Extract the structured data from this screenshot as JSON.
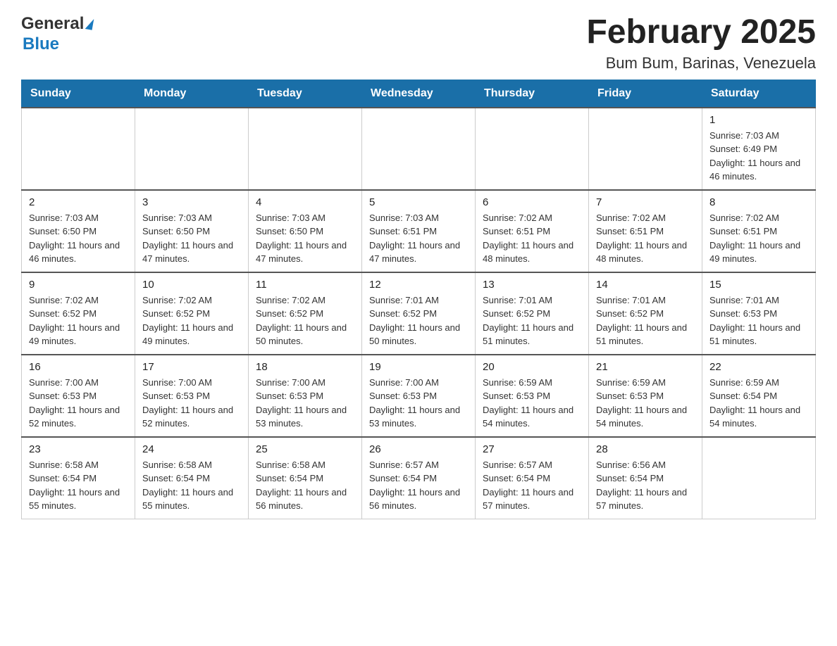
{
  "header": {
    "title": "February 2025",
    "location": "Bum Bum, Barinas, Venezuela",
    "logo_general": "General",
    "logo_blue": "Blue"
  },
  "weekdays": [
    "Sunday",
    "Monday",
    "Tuesday",
    "Wednesday",
    "Thursday",
    "Friday",
    "Saturday"
  ],
  "weeks": [
    [
      {
        "day": "",
        "info": ""
      },
      {
        "day": "",
        "info": ""
      },
      {
        "day": "",
        "info": ""
      },
      {
        "day": "",
        "info": ""
      },
      {
        "day": "",
        "info": ""
      },
      {
        "day": "",
        "info": ""
      },
      {
        "day": "1",
        "info": "Sunrise: 7:03 AM\nSunset: 6:49 PM\nDaylight: 11 hours and 46 minutes."
      }
    ],
    [
      {
        "day": "2",
        "info": "Sunrise: 7:03 AM\nSunset: 6:50 PM\nDaylight: 11 hours and 46 minutes."
      },
      {
        "day": "3",
        "info": "Sunrise: 7:03 AM\nSunset: 6:50 PM\nDaylight: 11 hours and 47 minutes."
      },
      {
        "day": "4",
        "info": "Sunrise: 7:03 AM\nSunset: 6:50 PM\nDaylight: 11 hours and 47 minutes."
      },
      {
        "day": "5",
        "info": "Sunrise: 7:03 AM\nSunset: 6:51 PM\nDaylight: 11 hours and 47 minutes."
      },
      {
        "day": "6",
        "info": "Sunrise: 7:02 AM\nSunset: 6:51 PM\nDaylight: 11 hours and 48 minutes."
      },
      {
        "day": "7",
        "info": "Sunrise: 7:02 AM\nSunset: 6:51 PM\nDaylight: 11 hours and 48 minutes."
      },
      {
        "day": "8",
        "info": "Sunrise: 7:02 AM\nSunset: 6:51 PM\nDaylight: 11 hours and 49 minutes."
      }
    ],
    [
      {
        "day": "9",
        "info": "Sunrise: 7:02 AM\nSunset: 6:52 PM\nDaylight: 11 hours and 49 minutes."
      },
      {
        "day": "10",
        "info": "Sunrise: 7:02 AM\nSunset: 6:52 PM\nDaylight: 11 hours and 49 minutes."
      },
      {
        "day": "11",
        "info": "Sunrise: 7:02 AM\nSunset: 6:52 PM\nDaylight: 11 hours and 50 minutes."
      },
      {
        "day": "12",
        "info": "Sunrise: 7:01 AM\nSunset: 6:52 PM\nDaylight: 11 hours and 50 minutes."
      },
      {
        "day": "13",
        "info": "Sunrise: 7:01 AM\nSunset: 6:52 PM\nDaylight: 11 hours and 51 minutes."
      },
      {
        "day": "14",
        "info": "Sunrise: 7:01 AM\nSunset: 6:52 PM\nDaylight: 11 hours and 51 minutes."
      },
      {
        "day": "15",
        "info": "Sunrise: 7:01 AM\nSunset: 6:53 PM\nDaylight: 11 hours and 51 minutes."
      }
    ],
    [
      {
        "day": "16",
        "info": "Sunrise: 7:00 AM\nSunset: 6:53 PM\nDaylight: 11 hours and 52 minutes."
      },
      {
        "day": "17",
        "info": "Sunrise: 7:00 AM\nSunset: 6:53 PM\nDaylight: 11 hours and 52 minutes."
      },
      {
        "day": "18",
        "info": "Sunrise: 7:00 AM\nSunset: 6:53 PM\nDaylight: 11 hours and 53 minutes."
      },
      {
        "day": "19",
        "info": "Sunrise: 7:00 AM\nSunset: 6:53 PM\nDaylight: 11 hours and 53 minutes."
      },
      {
        "day": "20",
        "info": "Sunrise: 6:59 AM\nSunset: 6:53 PM\nDaylight: 11 hours and 54 minutes."
      },
      {
        "day": "21",
        "info": "Sunrise: 6:59 AM\nSunset: 6:53 PM\nDaylight: 11 hours and 54 minutes."
      },
      {
        "day": "22",
        "info": "Sunrise: 6:59 AM\nSunset: 6:54 PM\nDaylight: 11 hours and 54 minutes."
      }
    ],
    [
      {
        "day": "23",
        "info": "Sunrise: 6:58 AM\nSunset: 6:54 PM\nDaylight: 11 hours and 55 minutes."
      },
      {
        "day": "24",
        "info": "Sunrise: 6:58 AM\nSunset: 6:54 PM\nDaylight: 11 hours and 55 minutes."
      },
      {
        "day": "25",
        "info": "Sunrise: 6:58 AM\nSunset: 6:54 PM\nDaylight: 11 hours and 56 minutes."
      },
      {
        "day": "26",
        "info": "Sunrise: 6:57 AM\nSunset: 6:54 PM\nDaylight: 11 hours and 56 minutes."
      },
      {
        "day": "27",
        "info": "Sunrise: 6:57 AM\nSunset: 6:54 PM\nDaylight: 11 hours and 57 minutes."
      },
      {
        "day": "28",
        "info": "Sunrise: 6:56 AM\nSunset: 6:54 PM\nDaylight: 11 hours and 57 minutes."
      },
      {
        "day": "",
        "info": ""
      }
    ]
  ]
}
